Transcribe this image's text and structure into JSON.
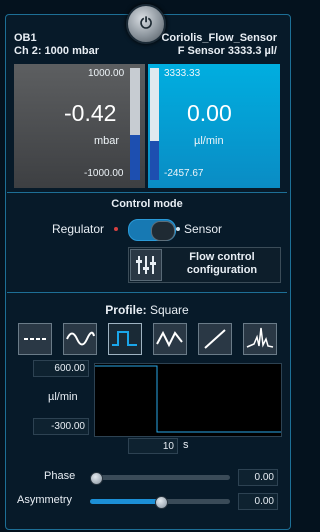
{
  "header": {
    "instrument": "OB1",
    "channel": "Ch 2: 1000 mbar",
    "sensor_name": "Coriolis_Flow_Sensor",
    "sensor_range": "F Sensor 3333.3 µl/",
    "power_icon": "power-icon"
  },
  "pressure": {
    "max": "1000.00",
    "min": "-1000.00",
    "value": "-0.42",
    "unit": "mbar",
    "level": 0.4
  },
  "flow": {
    "max": "3333.33",
    "min": "-2457.67",
    "value": "0.00",
    "unit": "µl/min",
    "level": 0.35
  },
  "control": {
    "title": "Control mode",
    "left_label": "Regulator",
    "right_label": "Sensor",
    "selected": "Sensor",
    "button_label_line1": "Flow control",
    "button_label_line2": "configuration",
    "button_icon": "sliders-icon"
  },
  "profile": {
    "label": "Profile:",
    "value": "Square",
    "waveforms": [
      {
        "name": "constant",
        "icon": "dashed-line-icon"
      },
      {
        "name": "sine",
        "icon": "sine-wave-icon"
      },
      {
        "name": "square",
        "icon": "square-wave-icon",
        "selected": true
      },
      {
        "name": "triangle",
        "icon": "triangle-wave-icon"
      },
      {
        "name": "ramp",
        "icon": "ramp-icon"
      },
      {
        "name": "custom",
        "icon": "spike-icon"
      }
    ],
    "y_max": "600.00",
    "y_min": "-300.00",
    "y_unit": "µl/min",
    "period": "10",
    "period_unit": "s",
    "phase_label": "Phase",
    "phase_value": "0.00",
    "phase_level": 0.0,
    "asym_label": "Asymmetry",
    "asym_value": "0.00",
    "asym_level": 0.5
  },
  "colors": {
    "accent": "#1d6f96",
    "flow_panel": "#00aee0",
    "pressure_panel": "#5d5f61",
    "bar_fill": "#1d4fb0"
  }
}
